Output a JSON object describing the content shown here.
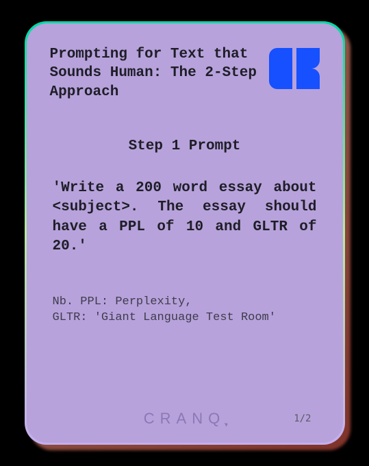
{
  "title": "Prompting for Text\nthat Sounds Human:\nThe 2-Step Approach",
  "section_title": "Step 1 Prompt",
  "prompt": "'Write a 200 word essay about  <subject>.   The essay should have a PPL of 10 and GLTR of 20.'",
  "note": "Nb.  PPL: Perplexity,\nGLTR: 'Giant Language Test Room'",
  "brand": "CRANQ",
  "page": "1/2",
  "accent_color": "#1650ff"
}
